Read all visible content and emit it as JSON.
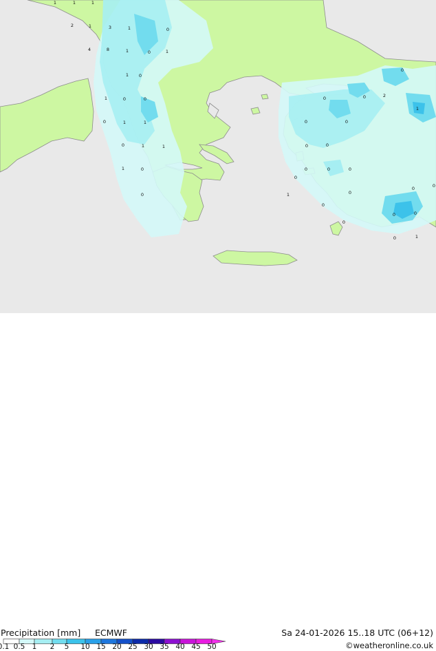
{
  "title": "Precipitation [mm]",
  "model": "ECMWF",
  "valid_time": "Sa 24-01-2026 15..18 UTC (06+12)",
  "credit": "©weatheronline.co.uk",
  "legend": {
    "ticks": [
      "0.1",
      "0.5",
      "1",
      "2",
      "5",
      "10",
      "15",
      "20",
      "25",
      "30",
      "35",
      "40",
      "45",
      "50"
    ],
    "colors": [
      "#ffffff",
      "#d4f8f8",
      "#a6eef2",
      "#72dcee",
      "#3cc2ea",
      "#2aa0e8",
      "#1e76dc",
      "#1450c8",
      "#0c2aa8",
      "#2a0aa0",
      "#8c10d0",
      "#c814d8",
      "#e81ce0",
      "#f430ec"
    ]
  },
  "colors": {
    "sea": "#e9e9e9",
    "land": "#cdf7a2",
    "precip_light": "#d4f8f8",
    "precip_mid": "#a6eef2",
    "precip_heavy": "#72dcee",
    "precip_very_heavy": "#3cc2ea",
    "coast": "#8c8c8c"
  },
  "map_labels": [
    "1",
    "1",
    "1",
    "2",
    "1",
    "3",
    "1",
    "0",
    "1",
    "4",
    "8",
    "1",
    "0",
    "1",
    "0",
    "1",
    "0",
    "0",
    "0",
    "1",
    "1",
    "0",
    "1",
    "1",
    "1",
    "0",
    "0",
    "0",
    "0",
    "0",
    "2",
    "1",
    "0",
    "0",
    "0",
    "0",
    "0",
    "0",
    "1",
    "0",
    "0",
    "0",
    "0",
    "0",
    "0",
    "1",
    "0",
    "0",
    "0",
    "0"
  ]
}
